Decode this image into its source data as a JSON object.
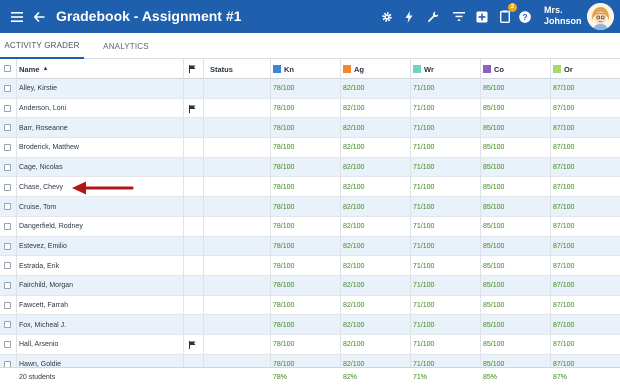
{
  "header": {
    "title": "Gradebook - Assignment #1",
    "user_name": "Mrs. Johnson",
    "notification_count": "2",
    "bar_color": "#1e5fae",
    "icons": [
      "menu-icon",
      "back-arrow-icon",
      "gear-icon",
      "lightning-icon",
      "wrench-icon",
      "filter-icon",
      "add-icon",
      "clipboard-icon",
      "help-icon"
    ]
  },
  "tabs": [
    {
      "label": "ACTIVITY GRADER",
      "active": true
    },
    {
      "label": "ANALYTICS",
      "active": false
    }
  ],
  "columns": {
    "name": "Name",
    "status": "Status",
    "categories": [
      {
        "label": "Kn",
        "color": "#3a86d8"
      },
      {
        "label": "Ag",
        "color": "#f08a2c"
      },
      {
        "label": "Wr",
        "color": "#6fd3c4"
      },
      {
        "label": "Co",
        "color": "#8e5fc4"
      },
      {
        "label": "Or",
        "color": "#a8d86a"
      }
    ]
  },
  "rows": [
    {
      "name": "Alley, Kirstie",
      "flag": false,
      "scores": [
        "78/100",
        "82/100",
        "71/100",
        "85/100",
        "87/100"
      ]
    },
    {
      "name": "Anderson, Loni",
      "flag": true,
      "scores": [
        "78/100",
        "82/100",
        "71/100",
        "85/100",
        "87/100"
      ]
    },
    {
      "name": "Barr, Roseanne",
      "flag": false,
      "scores": [
        "78/100",
        "82/100",
        "71/100",
        "85/100",
        "87/100"
      ]
    },
    {
      "name": "Broderick, Matthew",
      "flag": false,
      "scores": [
        "78/100",
        "82/100",
        "71/100",
        "85/100",
        "87/100"
      ]
    },
    {
      "name": "Cage, Nicolas",
      "flag": false,
      "scores": [
        "78/100",
        "82/100",
        "71/100",
        "85/100",
        "87/100"
      ]
    },
    {
      "name": "Chase, Chevy",
      "flag": false,
      "scores": [
        "78/100",
        "82/100",
        "71/100",
        "85/100",
        "87/100"
      ]
    },
    {
      "name": "Cruise, Tom",
      "flag": false,
      "scores": [
        "78/100",
        "82/100",
        "71/100",
        "85/100",
        "87/100"
      ]
    },
    {
      "name": "Dangerfield, Rodney",
      "flag": false,
      "scores": [
        "78/100",
        "82/100",
        "71/100",
        "85/100",
        "87/100"
      ]
    },
    {
      "name": "Estevez, Emilio",
      "flag": false,
      "scores": [
        "78/100",
        "82/100",
        "71/100",
        "85/100",
        "87/100"
      ]
    },
    {
      "name": "Estrada, Erik",
      "flag": false,
      "scores": [
        "78/100",
        "82/100",
        "71/100",
        "85/100",
        "87/100"
      ]
    },
    {
      "name": "Fairchild, Morgan",
      "flag": false,
      "scores": [
        "78/100",
        "82/100",
        "71/100",
        "85/100",
        "87/100"
      ]
    },
    {
      "name": "Fawcett, Farrah",
      "flag": false,
      "scores": [
        "78/100",
        "82/100",
        "71/100",
        "85/100",
        "87/100"
      ]
    },
    {
      "name": "Fox, Micheal J.",
      "flag": false,
      "scores": [
        "78/100",
        "82/100",
        "71/100",
        "85/100",
        "87/100"
      ]
    },
    {
      "name": "Hall, Arsenio",
      "flag": true,
      "scores": [
        "78/100",
        "82/100",
        "71/100",
        "85/100",
        "87/100"
      ]
    },
    {
      "name": "Hawn, Goldie",
      "flag": false,
      "scores": [
        "78/100",
        "82/100",
        "71/100",
        "85/100",
        "87/100"
      ]
    }
  ],
  "footer": {
    "count_label": "20 students",
    "averages": [
      "78%",
      "82%",
      "71%",
      "85%",
      "87%"
    ]
  },
  "score_color": "#3a8a12",
  "arrow_color": "#b01818"
}
